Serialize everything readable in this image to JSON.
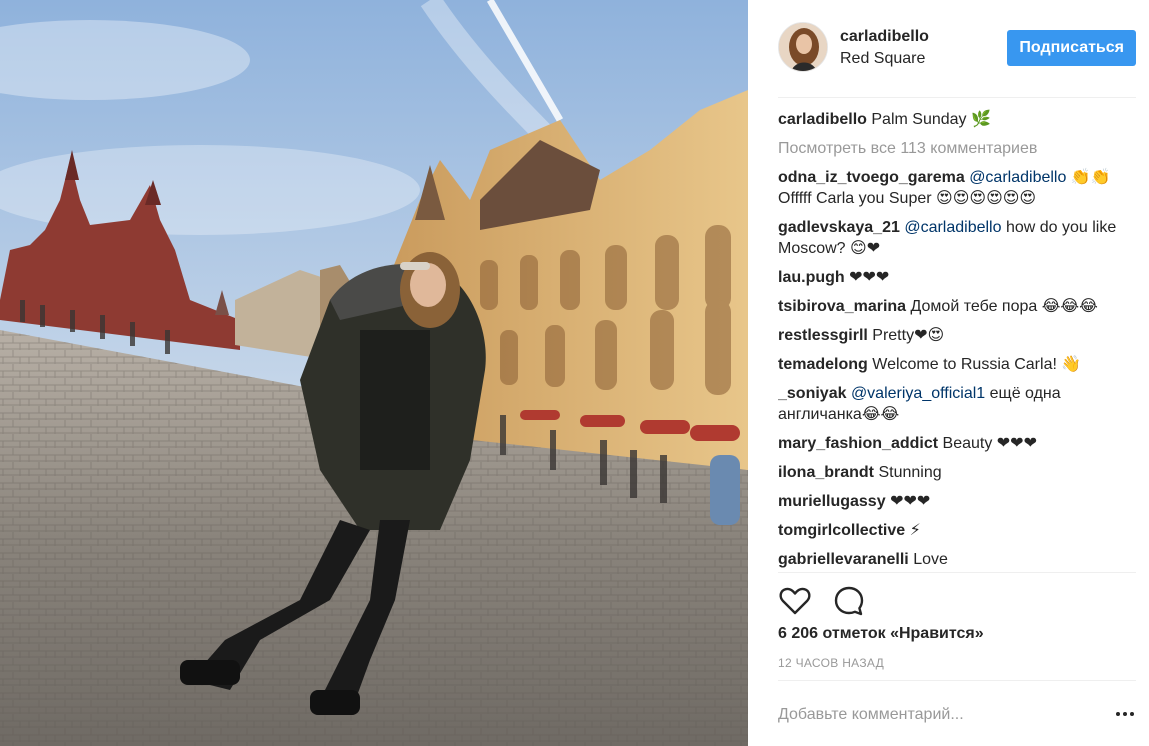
{
  "post": {
    "photo_alt": "",
    "author": {
      "username": "carladibello",
      "location": "Red Square"
    },
    "follow_label": "Подписаться",
    "caption": {
      "username": "carladibello",
      "text": "Palm Sunday 🌿"
    },
    "view_all": "Посмотреть все 113 комментариев",
    "comments": [
      {
        "username": "odna_iz_tvoego_garema",
        "mention": "@carladibello",
        "text": "👏👏Offfff Carla you Super 😍😍😍😍😍😍"
      },
      {
        "username": "gadlevskaya_21",
        "mention": "@carladibello",
        "text": "how do you like Moscow? 😊❤"
      },
      {
        "username": "lau.pugh",
        "mention": "",
        "text": "❤❤❤"
      },
      {
        "username": "tsibirova_marina",
        "mention": "",
        "text": "Домой тебе пора 😂😂😂"
      },
      {
        "username": "restlessgirll",
        "mention": "",
        "text": "Pretty❤😍"
      },
      {
        "username": "temadelong",
        "mention": "",
        "text": "Welcome to Russia Carla! 👋"
      },
      {
        "username": "_soniyak",
        "mention": "@valeriya_official1",
        "text": "ещё одна англичанка😂😂"
      },
      {
        "username": "mary_fashion_addict",
        "mention": "",
        "text": "Beauty ❤❤❤"
      },
      {
        "username": "ilona_brandt",
        "mention": "",
        "text": "Stunning"
      },
      {
        "username": "muriellugassy",
        "mention": "",
        "text": "❤❤❤"
      },
      {
        "username": "tomgirlcollective",
        "mention": "",
        "text": "⚡"
      },
      {
        "username": "gabriellevaranelli",
        "mention": "",
        "text": "Love"
      }
    ],
    "likes": "6 206 отметок «Нравится»",
    "time_ago": "12 ЧАСОВ НАЗАД",
    "add_comment_placeholder": "Добавьте комментарий...",
    "icons": {
      "like": "heart-icon",
      "comment": "comment-bubble-icon",
      "more": "more-options-icon"
    },
    "colors": {
      "follow_button": "#3897f0",
      "mention": "#003569",
      "muted": "#999999",
      "text": "#262626",
      "divider": "#efefef"
    }
  }
}
